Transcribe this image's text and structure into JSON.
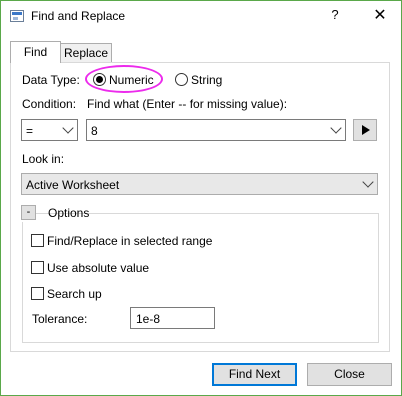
{
  "window": {
    "title": "Find and Replace",
    "help_label": "?",
    "close_label": "✕"
  },
  "tabs": [
    {
      "label": "Find",
      "active": true
    },
    {
      "label": "Replace",
      "active": false
    }
  ],
  "data_type": {
    "label": "Data Type:",
    "options": [
      {
        "label": "Numeric",
        "selected": true
      },
      {
        "label": "String",
        "selected": false
      }
    ]
  },
  "condition": {
    "label": "Condition:",
    "value": "="
  },
  "find_what": {
    "label": "Find what (Enter -- for missing value):",
    "value": "8"
  },
  "look_in": {
    "label": "Look in:",
    "value": "Active Worksheet"
  },
  "options": {
    "collapse_symbol": "-",
    "title": "Options",
    "checkboxes": [
      {
        "label": "Find/Replace in selected range",
        "checked": false
      },
      {
        "label": "Use absolute value",
        "checked": false
      },
      {
        "label": "Search up",
        "checked": false
      }
    ],
    "tolerance": {
      "label": "Tolerance:",
      "value": "1e-8"
    }
  },
  "buttons": {
    "find_next": "Find Next",
    "close": "Close"
  },
  "colors": {
    "highlight": "#ec2bec",
    "window_border": "#5aa84a",
    "primary_button_border": "#0078d7"
  }
}
